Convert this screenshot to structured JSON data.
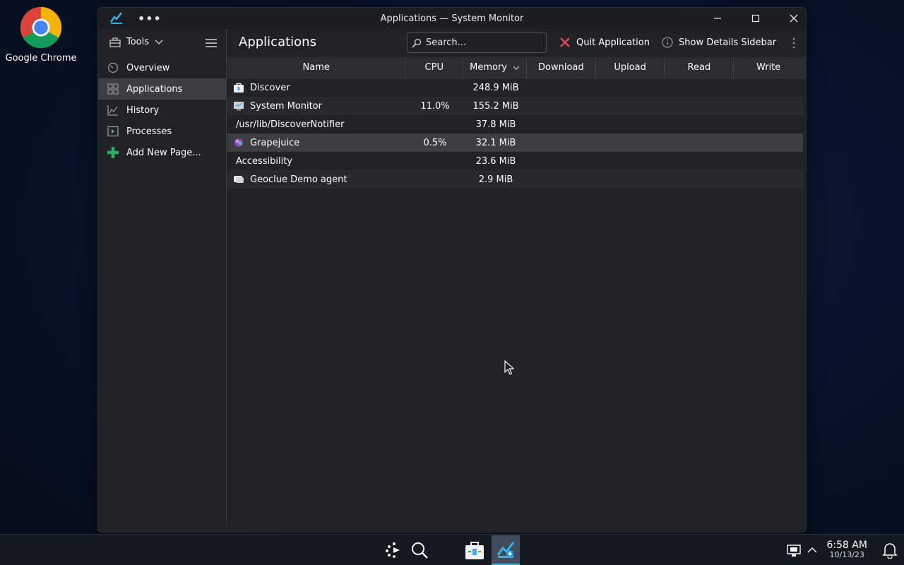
{
  "desktop": {
    "icons": [
      {
        "label": "Google Chrome",
        "icon": "chrome-icon"
      }
    ]
  },
  "window": {
    "title": "Applications — System Monitor",
    "menu_icon": "more-horizontal-icon",
    "controls": {
      "minimize": "minimize-icon",
      "maximize": "maximize-icon",
      "close": "close-icon"
    }
  },
  "sidebar": {
    "tools_label": "Tools",
    "items": [
      {
        "label": "Overview",
        "icon": "gauge-icon",
        "active": false
      },
      {
        "label": "Applications",
        "icon": "grid-icon",
        "active": true
      },
      {
        "label": "History",
        "icon": "chart-line-icon",
        "active": false
      },
      {
        "label": "Processes",
        "icon": "terminal-icon",
        "active": false
      },
      {
        "label": "Add New Page...",
        "icon": "plus-icon",
        "active": false
      }
    ]
  },
  "main": {
    "page_title": "Applications",
    "search": {
      "placeholder": "Search...",
      "value": ""
    },
    "quit_label": "Quit Application",
    "details_label": "Show Details Sidebar",
    "columns": [
      "Name",
      "CPU",
      "Memory",
      "Download",
      "Upload",
      "Read",
      "Write"
    ],
    "sort_column": "Memory",
    "rows": [
      {
        "name": "Discover",
        "icon": "discover-icon",
        "cpu": "",
        "memory": "248.9 MiB",
        "download": "",
        "upload": "",
        "read": "",
        "write": ""
      },
      {
        "name": "System Monitor",
        "icon": "system-monitor-icon",
        "cpu": "11.0%",
        "memory": "155.2 MiB",
        "download": "",
        "upload": "",
        "read": "",
        "write": ""
      },
      {
        "name": "/usr/lib/DiscoverNotifier",
        "icon": "",
        "cpu": "",
        "memory": "37.8 MiB",
        "download": "",
        "upload": "",
        "read": "",
        "write": ""
      },
      {
        "name": "Grapejuice",
        "icon": "grapejuice-icon",
        "cpu": "0.5%",
        "memory": "32.1 MiB",
        "download": "",
        "upload": "",
        "read": "",
        "write": ""
      },
      {
        "name": "Accessibility",
        "icon": "",
        "cpu": "",
        "memory": "23.6 MiB",
        "download": "",
        "upload": "",
        "read": "",
        "write": ""
      },
      {
        "name": "Geoclue Demo agent",
        "icon": "geoclue-icon",
        "cpu": "",
        "memory": "2.9 MiB",
        "download": "",
        "upload": "",
        "read": "",
        "write": ""
      }
    ]
  },
  "taskbar": {
    "icons": [
      "app-launcher-icon",
      "search-icon",
      "discover-icon",
      "system-monitor-icon"
    ],
    "clock": {
      "time": "6:58 AM",
      "date": "10/13/23"
    },
    "tray": [
      "display-icon",
      "chevron-up-icon",
      "bell-icon"
    ]
  },
  "colors": {
    "accent": "#3daee9",
    "window_bg": "#202326",
    "selection": "#3b3f44",
    "quit_red": "#da4453",
    "add_green": "#27ae60"
  }
}
